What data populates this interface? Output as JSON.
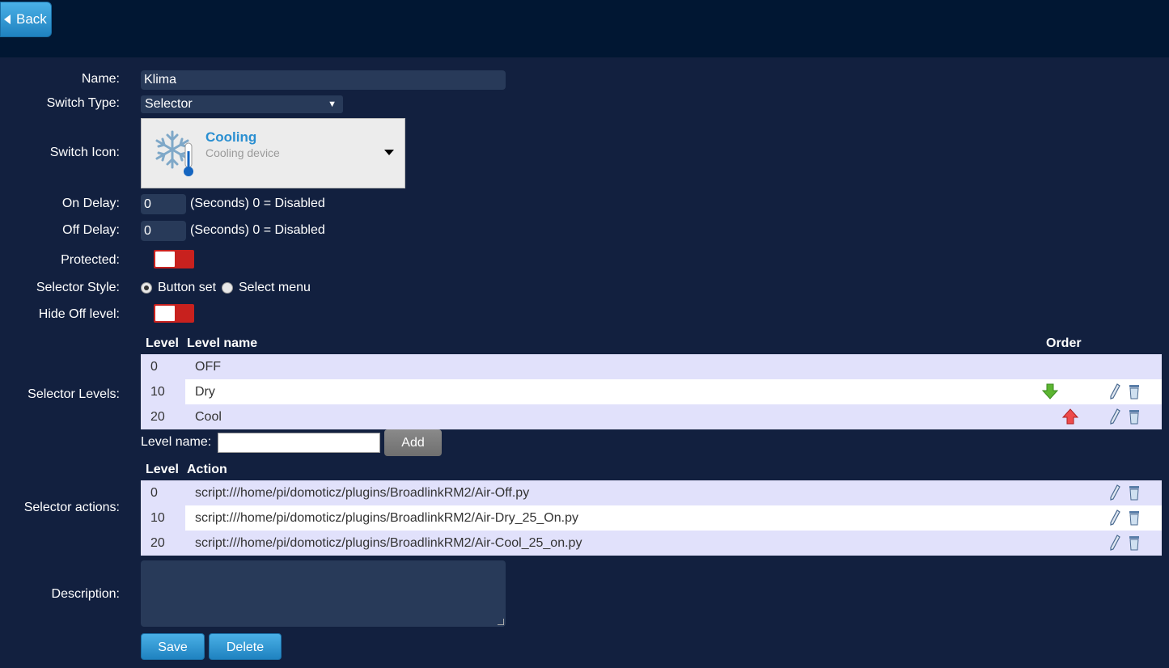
{
  "header": {
    "back_label": "Back"
  },
  "form": {
    "name_label": "Name:",
    "name_value": "Klima",
    "switch_type_label": "Switch Type:",
    "switch_type_value": "Selector",
    "switch_icon_label": "Switch Icon:",
    "icon_title": "Cooling",
    "icon_subtitle": "Cooling device",
    "on_delay_label": "On Delay:",
    "on_delay_value": "0",
    "off_delay_label": "Off Delay:",
    "off_delay_value": "0",
    "delay_hint": "(Seconds) 0 = Disabled",
    "protected_label": "Protected:",
    "selector_style_label": "Selector Style:",
    "style_option_1": "Button set",
    "style_option_2": "Select menu",
    "hide_off_label": "Hide Off level:",
    "selector_levels_label": "Selector Levels:",
    "selector_actions_label": "Selector actions:",
    "description_label": "Description:"
  },
  "levels_table": {
    "headers": {
      "level": "Level",
      "name": "Level name",
      "order": "Order"
    },
    "rows": [
      {
        "level": "0",
        "name": "OFF"
      },
      {
        "level": "10",
        "name": "Dry"
      },
      {
        "level": "20",
        "name": "Cool"
      }
    ]
  },
  "add_level": {
    "label": "Level name:",
    "button": "Add"
  },
  "actions_table": {
    "headers": {
      "level": "Level",
      "action": "Action"
    },
    "rows": [
      {
        "level": "0",
        "action": "script:///home/pi/domoticz/plugins/BroadlinkRM2/Air-Off.py"
      },
      {
        "level": "10",
        "action": "script:///home/pi/domoticz/plugins/BroadlinkRM2/Air-Dry_25_On.py"
      },
      {
        "level": "20",
        "action": "script:///home/pi/domoticz/plugins/BroadlinkRM2/Air-Cool_25_on.py"
      }
    ]
  },
  "buttons": {
    "save": "Save",
    "delete": "Delete"
  },
  "colors": {
    "toggle_off": "#c8211e",
    "button_blue": "#2a8fd1",
    "row_alt": "#e1e1fb",
    "background": "#12203f"
  }
}
